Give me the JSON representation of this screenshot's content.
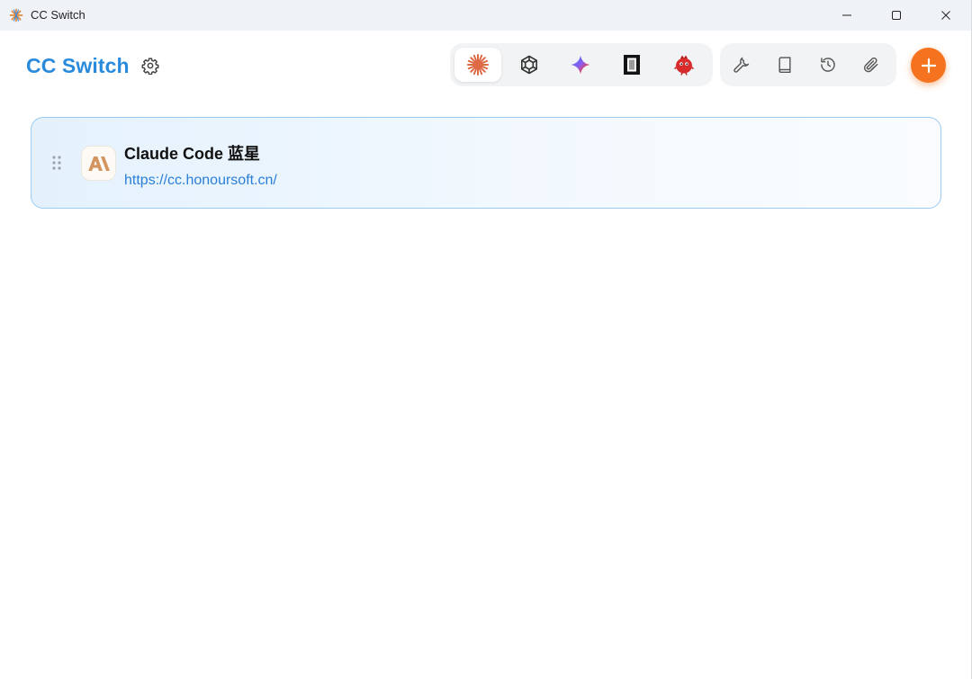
{
  "window": {
    "title": "CC Switch",
    "controls": [
      "minimize",
      "maximize",
      "close"
    ]
  },
  "header": {
    "brand": "CC Switch",
    "settings_icon": "gear-icon",
    "app_tabs": [
      {
        "id": "claude",
        "icon": "claude-sunburst-icon",
        "active": true
      },
      {
        "id": "codex",
        "icon": "openai-knot-icon",
        "active": false
      },
      {
        "id": "gemini",
        "icon": "gemini-sparkle-icon",
        "active": false
      },
      {
        "id": "terminal",
        "icon": "terminal-block-icon",
        "active": false
      },
      {
        "id": "bot",
        "icon": "red-bird-icon",
        "active": false
      }
    ],
    "tools": [
      {
        "id": "tools",
        "icon": "wrench-icon"
      },
      {
        "id": "docs",
        "icon": "book-icon"
      },
      {
        "id": "history",
        "icon": "history-icon"
      },
      {
        "id": "attachments",
        "icon": "paperclip-icon"
      }
    ],
    "add_icon": "plus-icon"
  },
  "providers": [
    {
      "name": "Claude Code 蓝星",
      "url": "https://cc.honoursoft.cn/",
      "logo_icon": "anthropic-logo-icon",
      "logo_text": "A\\"
    }
  ],
  "colors": {
    "brand": "#2a8bdc",
    "accent": "#f5731f",
    "card_border": "#9ccbf3",
    "link": "#2a7fd8"
  }
}
